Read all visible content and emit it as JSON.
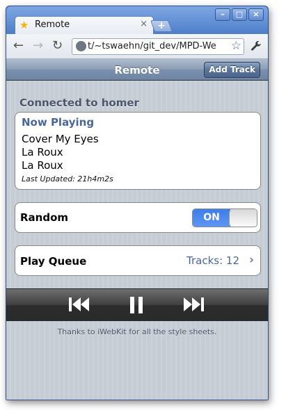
{
  "browser": {
    "tab_title": "Remote",
    "tab_close": "×",
    "new_tab": "+",
    "address": "t/~tswaehn/git_dev/MPD-We",
    "window_buttons": [
      "–",
      "□",
      "×"
    ],
    "nav_icons": [
      "back-arrow-icon",
      "forward-arrow-icon",
      "reload-icon",
      "star-icon",
      "wrench-icon"
    ]
  },
  "app": {
    "title": "Remote",
    "add_track_label": "Add Track",
    "connection_text": "Connected to homer"
  },
  "now_playing": {
    "heading": "Now Playing",
    "title": "Cover My Eyes",
    "artist": "La Roux",
    "album": "La Roux",
    "last_updated": "Last Updated: 21h4m2s"
  },
  "random": {
    "label": "Random",
    "state": "ON"
  },
  "queue": {
    "label": "Play Queue",
    "count_text": "Tracks: 12"
  },
  "controls": [
    "previous-icon",
    "pause-icon",
    "next-icon"
  ],
  "footer": "Thanks to iWebKit for all the style sheets.",
  "colors": {
    "window_frame": "#4a79c4",
    "navbar": "#6d84a3",
    "accent_text": "#4a6799",
    "toggle_on": "#3c7de8",
    "controls_bar": "#2c2c2c"
  }
}
